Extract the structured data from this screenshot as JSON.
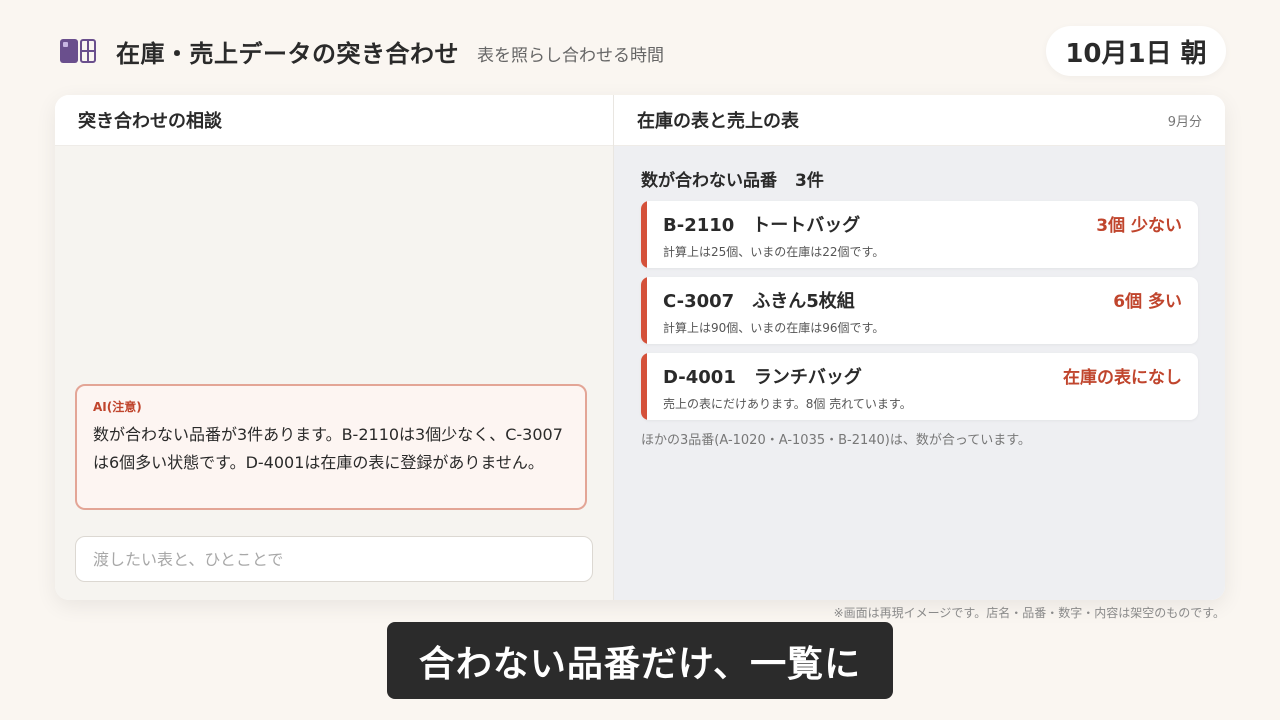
{
  "header": {
    "logo_icon": "table-grid-icon",
    "title": "在庫・売上データの突き合わせ",
    "subtitle": "表を照らし合わせる時間",
    "date_badge": "10月1日 朝"
  },
  "left_panel": {
    "title": "突き合わせの相談",
    "ai_message": {
      "label": "AI(注意)",
      "text": "数が合わない品番が3件あります。B-2110は3個少なく、C-3007は6個多い状態です。D-4001は在庫の表に登録がありません。"
    },
    "input": {
      "value": "",
      "placeholder": "渡したい表と、ひとことで"
    }
  },
  "right_panel": {
    "title": "在庫の表と売上の表",
    "period": "9月分",
    "section_title": "数が合わない品番",
    "section_count": "3件",
    "items": [
      {
        "code": "B-2110",
        "name": "トートバッグ",
        "diff": "3個 少ない",
        "detail": "計算上は25個、いまの在庫は22個です。"
      },
      {
        "code": "C-3007",
        "name": "ふきん5枚組",
        "diff": "6個 多い",
        "detail": "計算上は90個、いまの在庫は96個です。"
      },
      {
        "code": "D-4001",
        "name": "ランチバッグ",
        "diff": "在庫の表になし",
        "detail": "売上の表にだけあります。8個 売れています。"
      }
    ],
    "ok_note": "ほかの3品番(A-1020・A-1035・B-2140)は、数が合っています。"
  },
  "footer": {
    "disclaimer": "※画面は再現イメージです。店名・品番・数字・内容は架空のものです。",
    "caption": "合わない品番だけ、一覧に"
  },
  "colors": {
    "accent_red": "#c0452d",
    "logo_purple": "#6a4f8d"
  }
}
